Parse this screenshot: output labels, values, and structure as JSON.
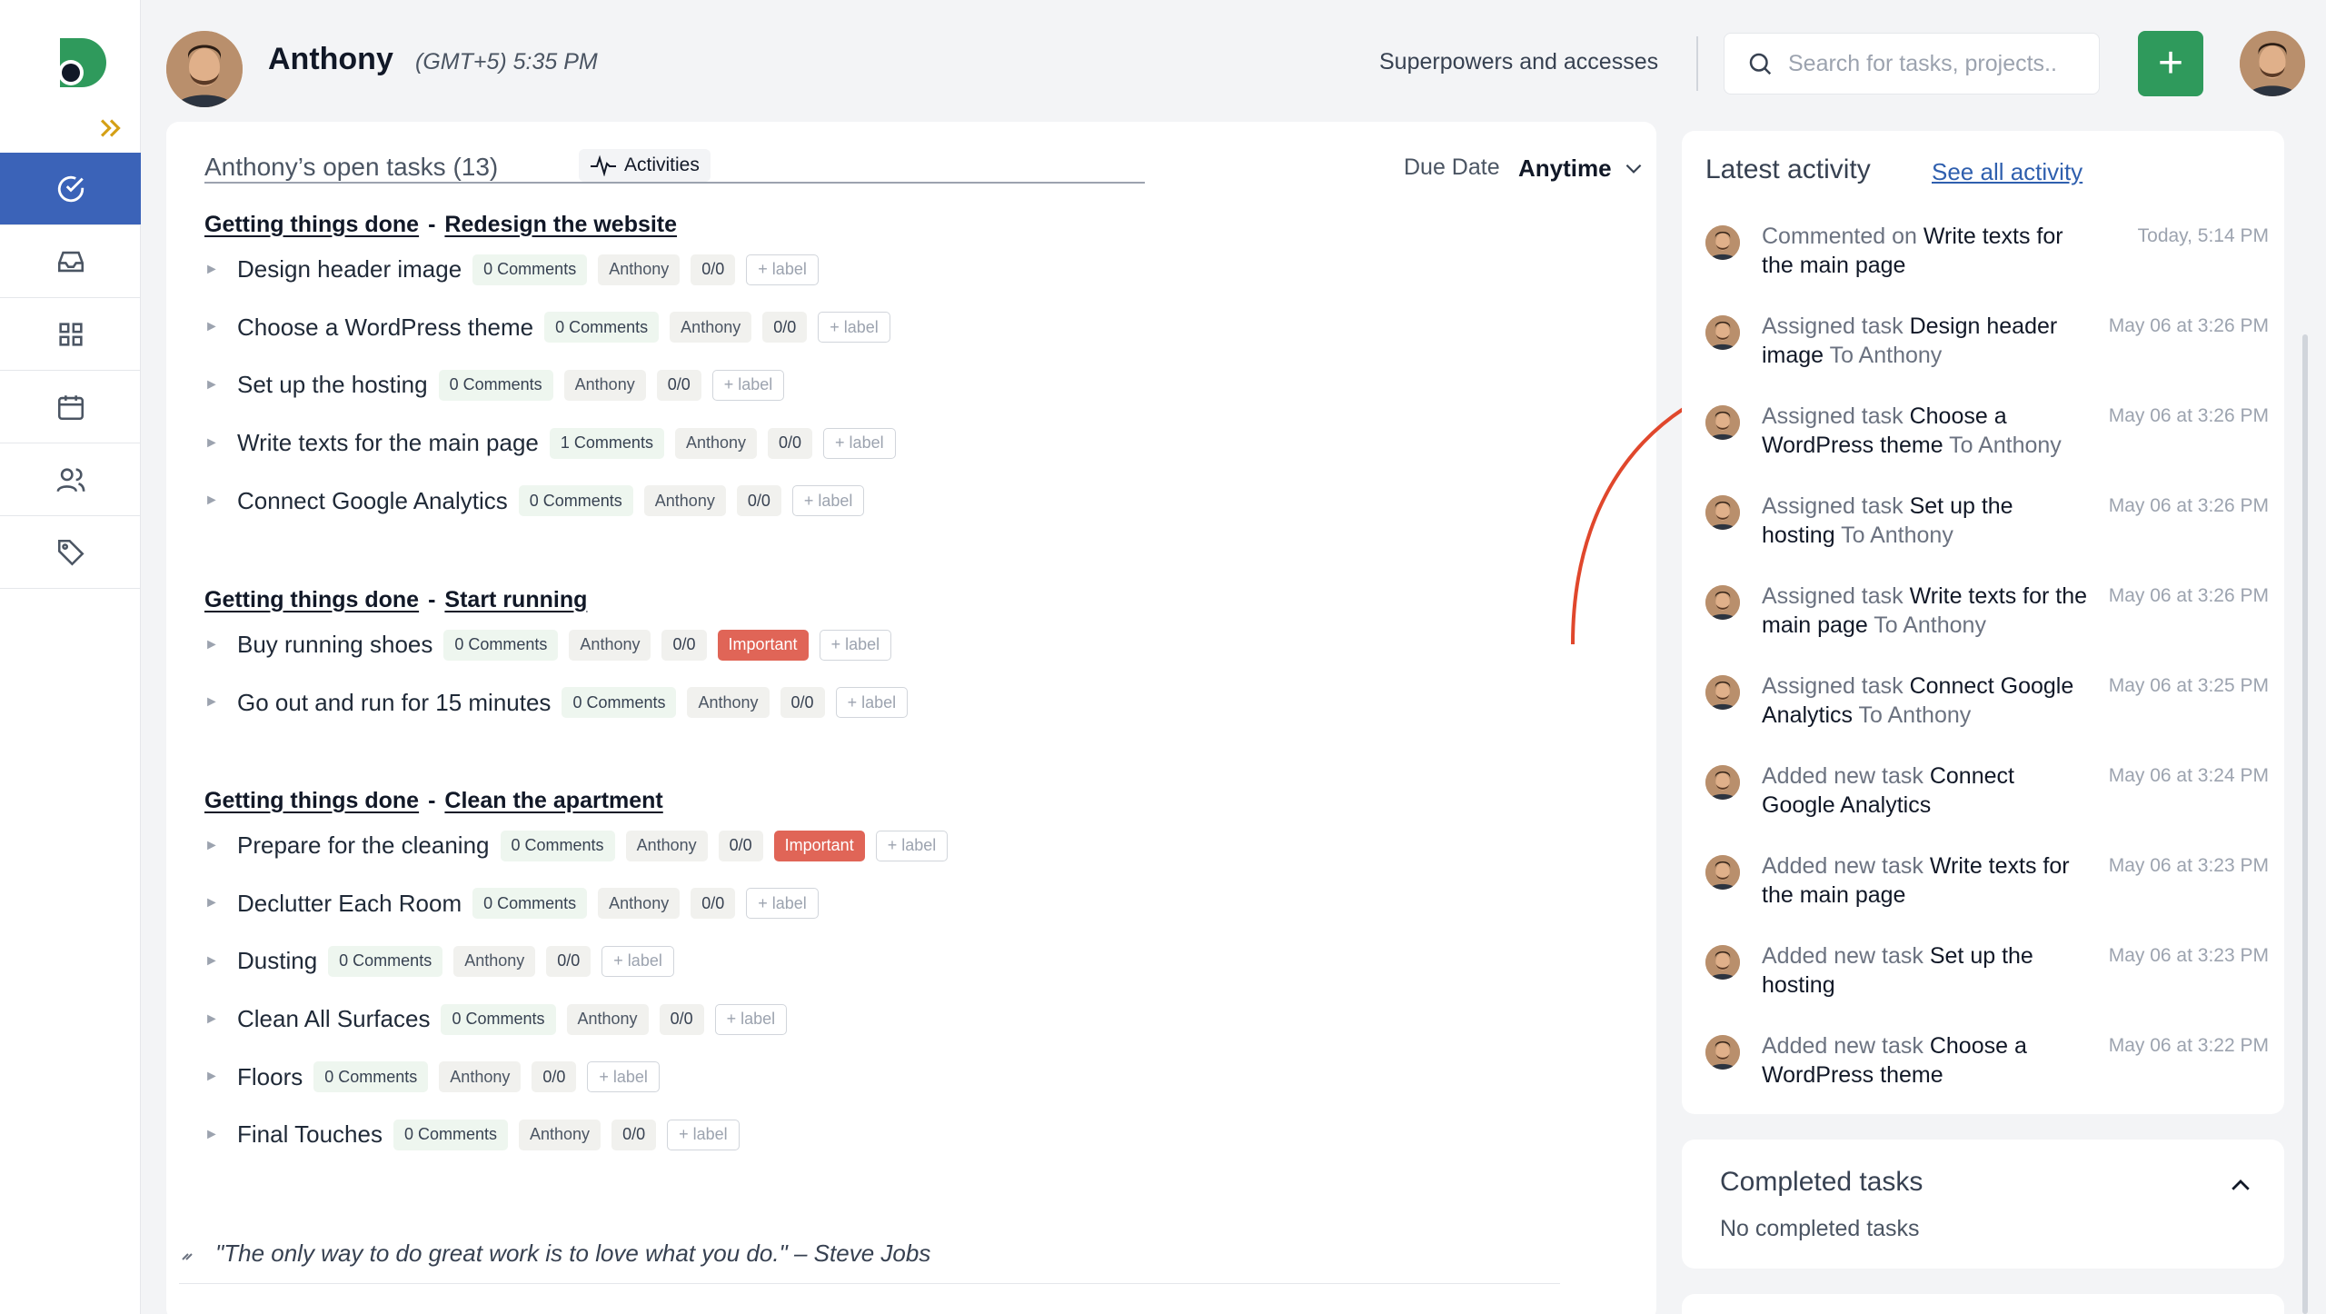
{
  "user": {
    "name": "Anthony",
    "timezone_time": "(GMT+5)  5:35 PM"
  },
  "header": {
    "superpowers_label": "Superpowers and accesses",
    "search_placeholder": "Search for tasks, projects..",
    "add_label": "+"
  },
  "nav": {
    "items": [
      {
        "icon": "check-circle-icon",
        "active": true
      },
      {
        "icon": "inbox-icon",
        "active": false
      },
      {
        "icon": "grid-icon",
        "active": false
      },
      {
        "icon": "calendar-icon",
        "active": false
      },
      {
        "icon": "users-icon",
        "active": false
      },
      {
        "icon": "tag-icon",
        "active": false
      }
    ]
  },
  "tasks_panel": {
    "title": "Anthony’s open tasks (13)",
    "activities_label": "Activities",
    "due_date_label": "Due Date",
    "due_date_value": "Anytime",
    "groups": [
      {
        "project": "Getting things done",
        "separator": "-",
        "list": "Redesign the website",
        "tasks": [
          {
            "name": "Design header image",
            "comments": "0 Comments",
            "assignee": "Anthony",
            "subtasks": "0/0",
            "important": "",
            "add_label": "+ label"
          },
          {
            "name": "Choose a WordPress theme",
            "comments": "0 Comments",
            "assignee": "Anthony",
            "subtasks": "0/0",
            "important": "",
            "add_label": "+ label"
          },
          {
            "name": "Set up the hosting",
            "comments": "0 Comments",
            "assignee": "Anthony",
            "subtasks": "0/0",
            "important": "",
            "add_label": "+ label"
          },
          {
            "name": "Write texts for the main page",
            "comments": "1 Comments",
            "assignee": "Anthony",
            "subtasks": "0/0",
            "important": "",
            "add_label": "+ label"
          },
          {
            "name": "Connect Google Analytics",
            "comments": "0 Comments",
            "assignee": "Anthony",
            "subtasks": "0/0",
            "important": "",
            "add_label": "+ label"
          }
        ]
      },
      {
        "project": "Getting things done",
        "separator": "-",
        "list": "Start running",
        "tasks": [
          {
            "name": "Buy running shoes",
            "comments": "0 Comments",
            "assignee": "Anthony",
            "subtasks": "0/0",
            "important": "Important",
            "add_label": "+ label"
          },
          {
            "name": "Go out and run for 15 minutes",
            "comments": "0 Comments",
            "assignee": "Anthony",
            "subtasks": "0/0",
            "important": "",
            "add_label": "+ label"
          }
        ]
      },
      {
        "project": "Getting things done",
        "separator": "-",
        "list": "Clean the apartment",
        "tasks": [
          {
            "name": "Prepare for the cleaning",
            "comments": "0 Comments",
            "assignee": "Anthony",
            "subtasks": "0/0",
            "important": "Important",
            "add_label": "+ label"
          },
          {
            "name": "Declutter Each Room",
            "comments": "0 Comments",
            "assignee": "Anthony",
            "subtasks": "0/0",
            "important": "",
            "add_label": "+ label"
          },
          {
            "name": "Dusting",
            "comments": "0 Comments",
            "assignee": "Anthony",
            "subtasks": "0/0",
            "important": "",
            "add_label": "+ label"
          },
          {
            "name": "Clean All Surfaces",
            "comments": "0 Comments",
            "assignee": "Anthony",
            "subtasks": "0/0",
            "important": "",
            "add_label": "+ label"
          },
          {
            "name": "Floors",
            "comments": "0 Comments",
            "assignee": "Anthony",
            "subtasks": "0/0",
            "important": "",
            "add_label": "+ label"
          },
          {
            "name": "Final Touches",
            "comments": "0 Comments",
            "assignee": "Anthony",
            "subtasks": "0/0",
            "important": "",
            "add_label": "+ label"
          }
        ]
      }
    ],
    "quote": "\"The only way to do great work is to love what you do.\" – Steve Jobs"
  },
  "activity": {
    "title": "Latest activity",
    "see_all": "See all activity",
    "items": [
      {
        "action": "Commented on ",
        "object": "Write texts for the main page",
        "target": "",
        "time": "Today, 5:14 PM"
      },
      {
        "action": "Assigned task ",
        "object": "Design header image",
        "target": " To Anthony",
        "time": "May 06 at 3:26 PM"
      },
      {
        "action": "Assigned task ",
        "object": "Choose a WordPress theme",
        "target": " To Anthony",
        "time": "May 06 at 3:26 PM"
      },
      {
        "action": "Assigned task ",
        "object": "Set up the hosting",
        "target": " To Anthony",
        "time": "May 06 at 3:26 PM"
      },
      {
        "action": "Assigned task ",
        "object": "Write texts for the main page",
        "target": " To Anthony",
        "time": "May 06 at 3:26 PM"
      },
      {
        "action": "Assigned task ",
        "object": "Connect Google Analytics",
        "target": " To Anthony",
        "time": "May 06 at 3:25 PM"
      },
      {
        "action": "Added new task ",
        "object": "Connect Google Analytics",
        "target": "",
        "time": "May 06 at 3:24 PM"
      },
      {
        "action": "Added new task ",
        "object": "Write texts for the main page",
        "target": "",
        "time": "May 06 at 3:23 PM"
      },
      {
        "action": "Added new task ",
        "object": "Set up the hosting",
        "target": "",
        "time": "May 06 at 3:23 PM"
      },
      {
        "action": "Added new task ",
        "object": "Choose a WordPress theme",
        "target": "",
        "time": "May 06 at 3:22 PM"
      }
    ]
  },
  "completed": {
    "title": "Completed tasks",
    "empty_text": "No completed tasks"
  },
  "colors": {
    "nav_active": "#3b63b8",
    "add_button": "#2f9a5c",
    "important": "#e06557",
    "link": "#2f5fae",
    "arrow": "#e0472c",
    "accent_gold": "#d4a017"
  }
}
